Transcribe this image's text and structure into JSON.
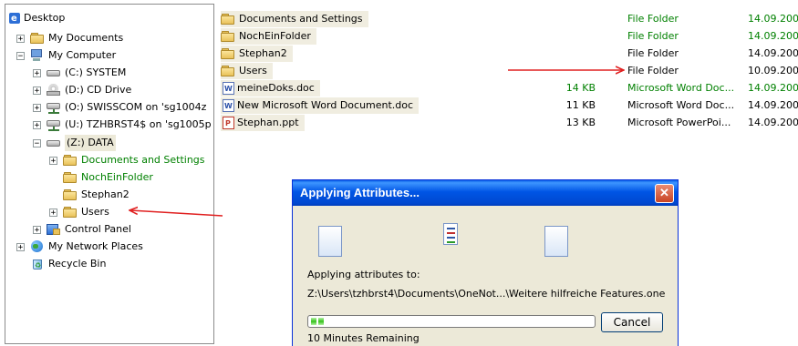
{
  "tree": {
    "items": [
      {
        "label": "Desktop",
        "icon": "desktop-icon",
        "expander": ""
      },
      {
        "label": "My Documents",
        "icon": "my-documents-icon",
        "expander": "+"
      },
      {
        "label": "My Computer",
        "icon": "my-computer-icon",
        "expander": "−"
      },
      {
        "label": "(C:) SYSTEM",
        "icon": "drive-icon",
        "expander": "+"
      },
      {
        "label": "(D:) CD Drive",
        "icon": "cd-drive-icon",
        "expander": "+"
      },
      {
        "label": "(O:) SWISSCOM on 'sg1004z",
        "icon": "network-drive-icon",
        "expander": "+"
      },
      {
        "label": "(U:) TZHBRST4$ on 'sg1005p",
        "icon": "network-drive-icon",
        "expander": "+"
      },
      {
        "label": "(Z:) DATA",
        "icon": "drive-icon",
        "expander": "−"
      },
      {
        "label": "Documents and Settings",
        "icon": "folder-icon",
        "expander": "+"
      },
      {
        "label": "NochEinFolder",
        "icon": "folder-icon",
        "expander": ""
      },
      {
        "label": "Stephan2",
        "icon": "folder-icon",
        "expander": ""
      },
      {
        "label": "Users",
        "icon": "folder-icon",
        "expander": "+"
      },
      {
        "label": "Control Panel",
        "icon": "control-panel-icon",
        "expander": "+"
      },
      {
        "label": "My Network Places",
        "icon": "network-places-icon",
        "expander": "+"
      },
      {
        "label": "Recycle Bin",
        "icon": "recycle-bin-icon",
        "expander": ""
      }
    ]
  },
  "files": [
    {
      "name": "Documents and Settings",
      "size": "",
      "type": "File Folder",
      "date": "14.09.200",
      "icon": "folder-icon"
    },
    {
      "name": "NochEinFolder",
      "size": "",
      "type": "File Folder",
      "date": "14.09.200",
      "icon": "folder-icon"
    },
    {
      "name": "Stephan2",
      "size": "",
      "type": "File Folder",
      "date": "14.09.200",
      "icon": "folder-icon"
    },
    {
      "name": "Users",
      "size": "",
      "type": "File Folder",
      "date": "10.09.200",
      "icon": "folder-icon"
    },
    {
      "name": "meineDoks.doc",
      "size": "14 KB",
      "type": "Microsoft Word Doc...",
      "date": "14.09.200",
      "icon": "word-doc-icon"
    },
    {
      "name": "New Microsoft Word Document.doc",
      "size": "11 KB",
      "type": "Microsoft Word Doc...",
      "date": "14.09.200",
      "icon": "word-doc-icon"
    },
    {
      "name": "Stephan.ppt",
      "size": "13 KB",
      "type": "Microsoft PowerPoi...",
      "date": "14.09.200",
      "icon": "powerpoint-icon"
    }
  ],
  "dialog": {
    "title": "Applying Attributes...",
    "close": "✕",
    "label": "Applying attributes to:",
    "path": "Z:\\Users\\tzhbrst4\\Documents\\OneNot...\\Weitere hilfreiche Features.one",
    "progress": 0.06,
    "cancel": "Cancel",
    "remaining": "10 Minutes Remaining"
  },
  "colors": {
    "green_text": "#008000",
    "arrow": "#e02020",
    "title_bar": "#0055e5"
  }
}
